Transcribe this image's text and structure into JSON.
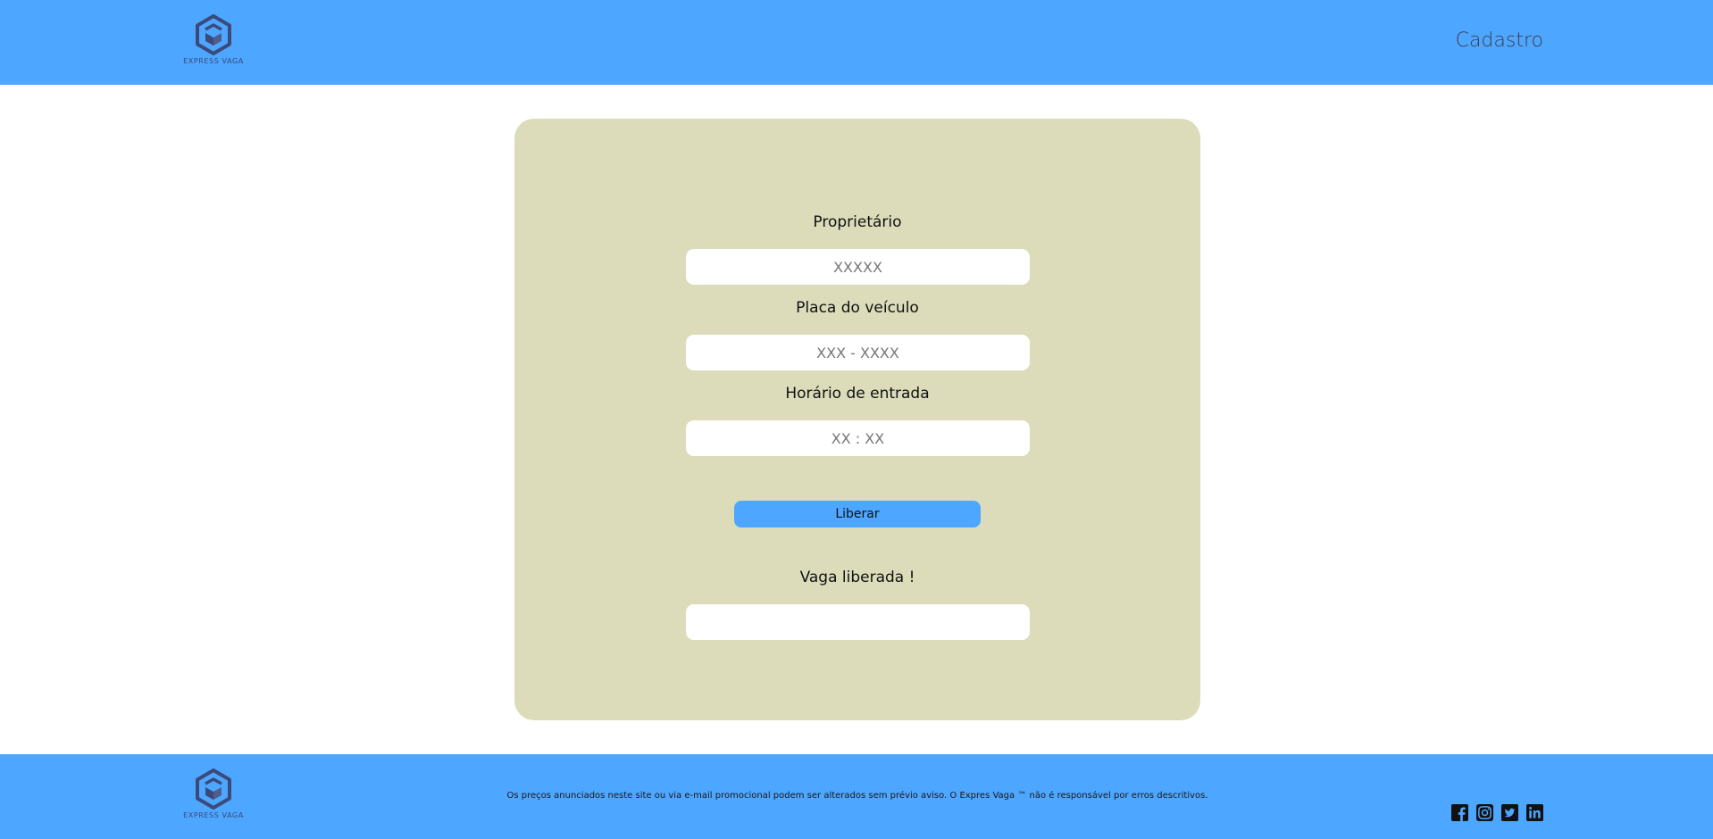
{
  "header": {
    "logo_text": "EXPRESS VAGA",
    "nav_link": "Cadastro"
  },
  "form": {
    "owner": {
      "label": "Proprietário",
      "placeholder": "XXXXX"
    },
    "plate": {
      "label": "Placa do veículo",
      "placeholder": "XXX - XXXX"
    },
    "entry_time": {
      "label": "Horário de entrada",
      "placeholder": "XX : XX"
    },
    "submit_label": "Liberar",
    "result": {
      "label": "Vaga liberada !",
      "value": ""
    }
  },
  "footer": {
    "logo_text": "EXPRESS VAGA",
    "disclaimer": "Os preços anunciados neste site ou via e-mail promocional podem ser alterados sem prévio aviso. O Expres Vaga ™ não é responsável por erros descritivos.",
    "socials": [
      "facebook-icon",
      "instagram-icon",
      "twitter-icon",
      "linkedin-icon"
    ]
  },
  "colors": {
    "header_bg": "#4da6ff",
    "card_bg": "#dcdcbb",
    "button_bg": "#4da6ff",
    "logo": "#3b4a7a"
  }
}
